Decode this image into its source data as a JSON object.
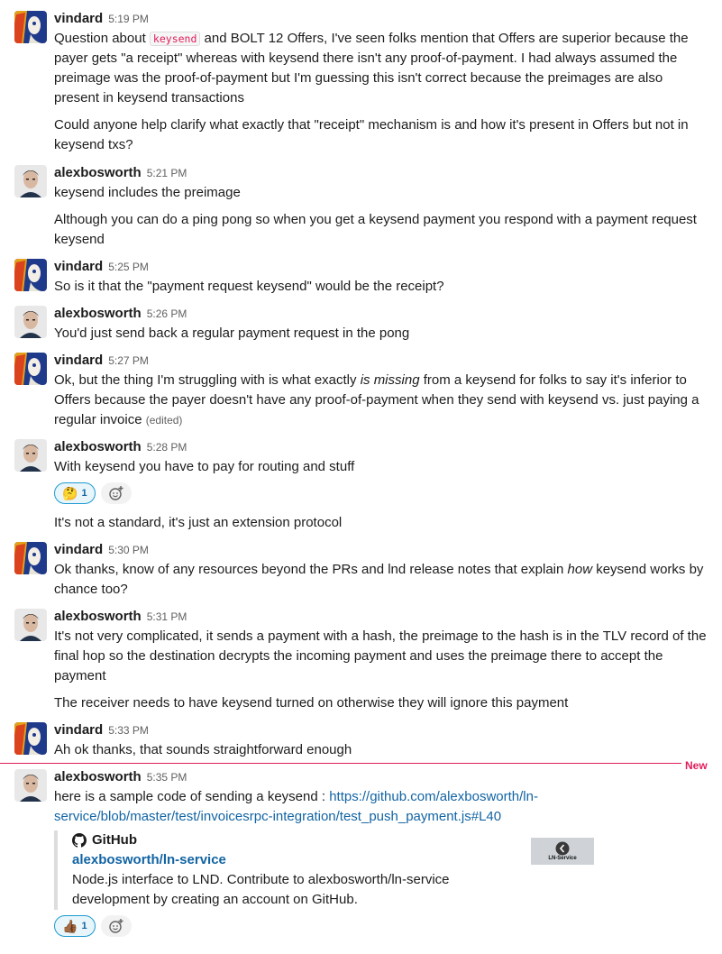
{
  "colors": {
    "accent_new": "#e01e5a",
    "link": "#1264a3",
    "code": "#e01e5a"
  },
  "divider": {
    "label": "New"
  },
  "messages": [
    {
      "author": "vindard",
      "time": "5:19 PM",
      "p1_a": "Question about ",
      "p1_code": "keysend",
      "p1_b": " and BOLT 12 Offers, I've seen folks mention that Offers are superior because the payer gets \"a receipt\" whereas with keysend there isn't any proof-of-payment. I had always assumed the preimage was the proof-of-payment but I'm guessing this isn't correct because the preimages are also present in keysend transactions",
      "p2": "Could anyone help clarify what exactly that \"receipt\" mechanism is and how it's present in Offers but not in keysend txs?"
    },
    {
      "author": "alexbosworth",
      "time": "5:21 PM",
      "p1": "keysend includes the preimage",
      "p2": "Although you can do a ping pong so when you get a keysend payment you respond with a payment request keysend"
    },
    {
      "author": "vindard",
      "time": "5:25 PM",
      "p1": "So is it that the \"payment request keysend\" would be the receipt?"
    },
    {
      "author": "alexbosworth",
      "time": "5:26 PM",
      "p1": "You'd just send back a regular payment request in the pong"
    },
    {
      "author": "vindard",
      "time": "5:27 PM",
      "p1_a": "Ok, but the thing I'm struggling with is what exactly ",
      "p1_em": "is missing",
      "p1_b": " from a keysend for folks to say it's inferior to Offers because the payer doesn't have any proof-of-payment when they send with keysend vs. just paying a regular invoice",
      "edited": "(edited)"
    },
    {
      "author": "alexbosworth",
      "time": "5:28 PM",
      "p1": "With keysend you have to pay for routing and stuff",
      "reaction": {
        "emoji": "🤔",
        "count": "1"
      },
      "p2": "It's not a standard, it's just an extension protocol"
    },
    {
      "author": "vindard",
      "time": "5:30 PM",
      "p1_a": "Ok thanks, know of any resources beyond the PRs and lnd release notes that explain ",
      "p1_em": "how",
      "p1_b": " keysend works by chance too?"
    },
    {
      "author": "alexbosworth",
      "time": "5:31 PM",
      "p1": "It's not very complicated, it sends a payment with a hash, the preimage to the hash is in the TLV record of the final hop so the destination decrypts the incoming payment and uses the preimage there to accept the payment",
      "p2": "The receiver needs to have keysend turned on otherwise they will ignore this payment"
    },
    {
      "author": "vindard",
      "time": "5:33 PM",
      "p1": "Ah ok thanks, that sounds straightforward enough"
    },
    {
      "author": "alexbosworth",
      "time": "5:35 PM",
      "p1": "here is a sample code of sending a keysend : ",
      "link": "https://github.com/alexbosworth/ln-service/blob/master/test/invoicesrpc-integration/test_push_payment.js#L40",
      "unfurl": {
        "site": "GitHub",
        "title": "alexbosworth/ln-service",
        "desc": "Node.js interface to LND. Contribute to alexbosworth/ln-service development by creating an account on GitHub.",
        "thumb_label": "LN-Service"
      },
      "reaction": {
        "emoji": "👍🏾",
        "count": "1"
      }
    }
  ]
}
